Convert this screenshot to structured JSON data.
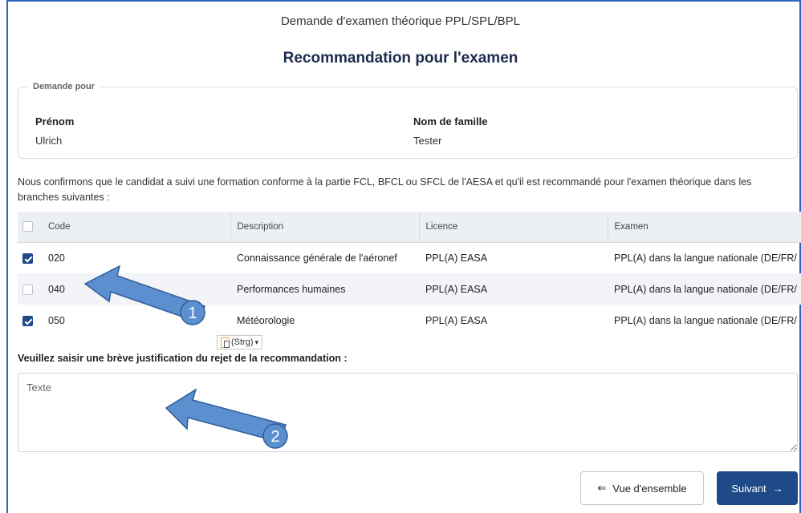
{
  "header": {
    "subtitle": "Demande d'examen théorique PPL/SPL/BPL",
    "title": "Recommandation pour l'examen"
  },
  "request": {
    "legend": "Demande pour",
    "first_name_label": "Prénom",
    "first_name_value": "Ulrich",
    "last_name_label": "Nom de famille",
    "last_name_value": "Tester"
  },
  "confirmation_text": "Nous confirmons que le candidat a suivi une formation conforme à la partie FCL, BFCL ou SFCL de l'AESA et qu'il est recommandé pour l'examen théorique dans les branches suivantes :",
  "table": {
    "columns": [
      "Code",
      "Description",
      "Licence",
      "Examen"
    ],
    "select_all_checked": false,
    "rows": [
      {
        "checked": true,
        "code": "020",
        "description": "Connaissance générale de l'aéronef",
        "licence": "PPL(A) EASA",
        "exam": "PPL(A) dans la langue nationale (DE/FR/"
      },
      {
        "checked": false,
        "code": "040",
        "description": "Performances humaines",
        "licence": "PPL(A) EASA",
        "exam": "PPL(A) dans la langue nationale (DE/FR/"
      },
      {
        "checked": true,
        "code": "050",
        "description": "Météorologie",
        "licence": "PPL(A) EASA",
        "exam": "PPL(A) dans la langue nationale (DE/FR/"
      }
    ]
  },
  "paste_popup": {
    "label": "(Strg)",
    "caret": "▾"
  },
  "justification": {
    "label": "Veuillez saisir une brève justification du rejet de la recommandation :",
    "placeholder": "Texte",
    "value": ""
  },
  "buttons": {
    "overview_icon": "⇐",
    "overview_label": "Vue d'ensemble",
    "next_label": "Suivant",
    "next_icon": "→"
  },
  "annotations": {
    "arrow_1_number": "1",
    "arrow_2_number": "2",
    "arrow_color": "#5b8fd0"
  },
  "colors": {
    "primary": "#1f4a8a",
    "title": "#1d2b4f",
    "frame": "#2f66c4",
    "table_header_bg": "#eceff3"
  }
}
